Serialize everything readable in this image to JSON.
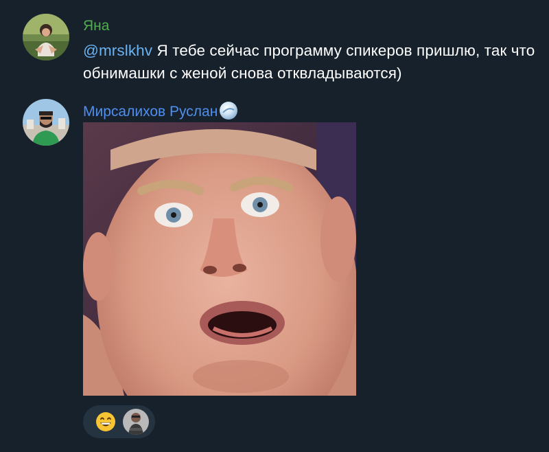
{
  "messages": [
    {
      "sender": "Яна",
      "sender_color": "#4fae4e",
      "mention": "@mrslkhv",
      "text": " Я тебе сейчас программу спикеров пришлю, так что обнимашки с женой снова отквладываются)"
    },
    {
      "sender": "Мирсалихов Руслан",
      "sender_color": "#4e8ff0",
      "sender_badge_icon": "premium-star-icon",
      "attachment": "photo",
      "reactions": [
        {
          "emoji": "😁"
        }
      ]
    }
  ],
  "colors": {
    "background": "#17212b",
    "mention": "#6ab3f3",
    "text": "#ffffff",
    "reaction_bg": "#253240"
  }
}
